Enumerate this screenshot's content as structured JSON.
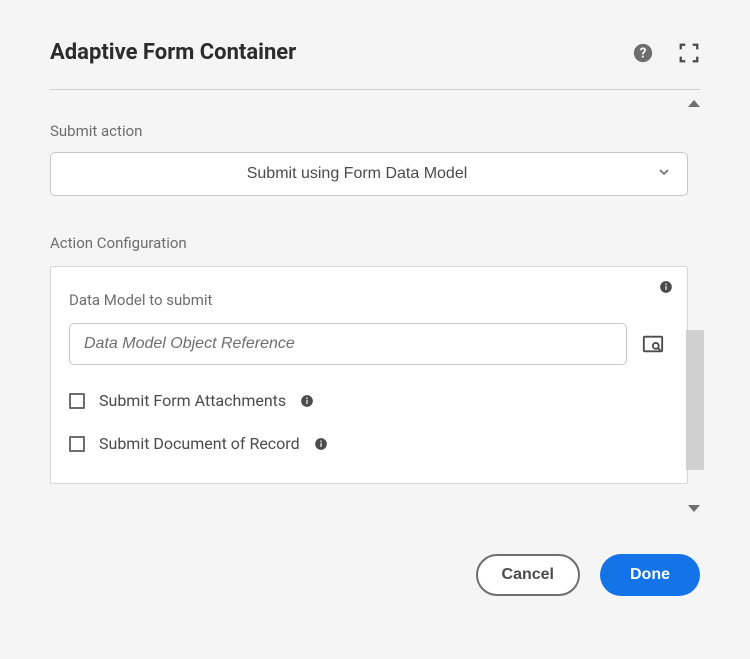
{
  "header": {
    "title": "Adaptive Form Container"
  },
  "submitAction": {
    "label": "Submit action",
    "value": "Submit using Form Data Model"
  },
  "actionConfig": {
    "heading": "Action Configuration",
    "dataModel": {
      "label": "Data Model to submit",
      "placeholder": "Data Model Object Reference",
      "value": ""
    },
    "checkboxes": {
      "attachments": {
        "label": "Submit Form Attachments",
        "checked": false
      },
      "dor": {
        "label": "Submit Document of Record",
        "checked": false
      }
    }
  },
  "footer": {
    "cancel": "Cancel",
    "done": "Done"
  }
}
